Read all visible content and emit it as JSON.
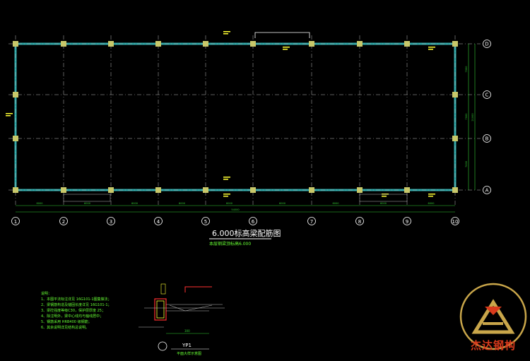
{
  "drawing": {
    "title": "6.000标高梁配筋图",
    "subtitle": "本层钢梁顶标高6.000",
    "grid_columns": [
      "1",
      "2",
      "3",
      "4",
      "5",
      "6",
      "7",
      "8",
      "9",
      "10"
    ],
    "grid_rows": [
      "D",
      "C",
      "B",
      "A"
    ],
    "span_dims": [
      "6000",
      "6000",
      "6000",
      "6000",
      "6000",
      "6000",
      "6000",
      "6000",
      "6000"
    ],
    "total_dim": "54000",
    "right_dims": [
      "7000",
      "7000",
      "7000"
    ],
    "right_total": "21000"
  },
  "notes": {
    "heading": "说明：",
    "items": [
      "1、本图平法标注详见 16G101-1图集做法；",
      "2、梁钢筋构造及锚固长度详见 16G101-1；",
      "3、梁砼强度等级C30，保护层厚度 25；",
      "4、除注明外，梁中心线均与轴线居中；",
      "5、钢筋采用 HRB400 级钢筋；",
      "6、其余说明详见结构总说明。"
    ]
  },
  "detail": {
    "label": "YP1",
    "caption": "平面大样示意图",
    "dim": "300"
  },
  "logo": {
    "text": "杰达钢构"
  },
  "colors": {
    "background": "#000000",
    "grid_line": "#bbbbbb",
    "beam": "#2fa8a8",
    "column": "#c8c86a",
    "dim": "#33cc33",
    "annotation": "#ffff33",
    "detail_red": "#ff3030",
    "logo_gold": "#c9a64a",
    "logo_red": "#d93a1c"
  }
}
